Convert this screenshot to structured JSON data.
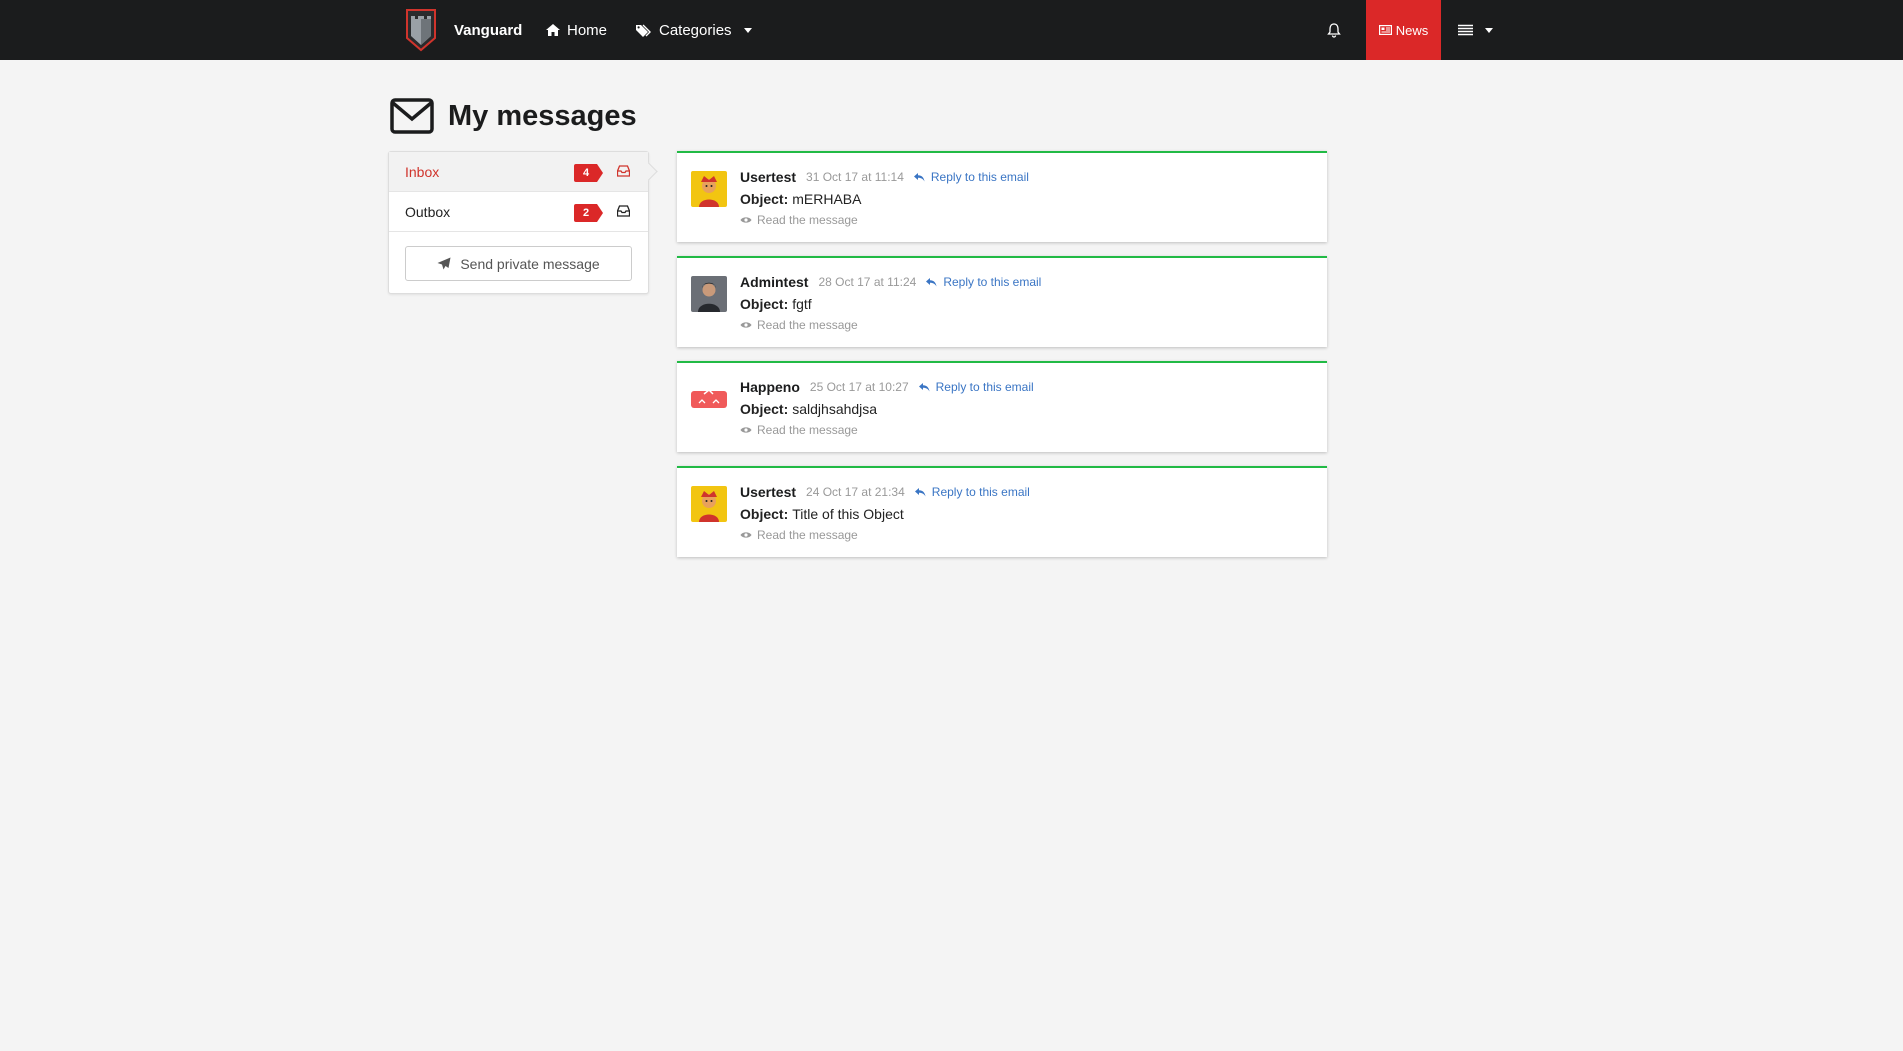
{
  "nav": {
    "brand": "Vanguard",
    "home": "Home",
    "categories": "Categories",
    "news": "News",
    "colors": {
      "bar": "#1b1c1d",
      "news_bg": "#db2828"
    }
  },
  "page": {
    "title": "My messages"
  },
  "sidebar": {
    "items": [
      {
        "label": "Inbox",
        "count": "4",
        "active": true
      },
      {
        "label": "Outbox",
        "count": "2",
        "active": false
      }
    ],
    "send_label": "Send private message"
  },
  "messages": [
    {
      "user": "Usertest",
      "date": "31 Oct 17 at 11:14",
      "reply": "Reply to this email",
      "object_label": "Object:",
      "object": "mERHABA",
      "read": "Read the message",
      "avatar": "yellow-character-avatar"
    },
    {
      "user": "Admintest",
      "date": "28 Oct 17 at 11:24",
      "reply": "Reply to this email",
      "object_label": "Object:",
      "object": "fgtf",
      "read": "Read the message",
      "avatar": "gray-person-avatar"
    },
    {
      "user": "Happeno",
      "date": "25 Oct 17 at 10:27",
      "reply": "Reply to this email",
      "object_label": "Object:",
      "object": "saldjhsahdjsa",
      "read": "Read the message",
      "avatar": "red-character-avatar"
    },
    {
      "user": "Usertest",
      "date": "24 Oct 17 at 21:34",
      "reply": "Reply to this email",
      "object_label": "Object:",
      "object": "Title of this Object",
      "read": "Read the message",
      "avatar": "yellow-character-avatar"
    }
  ],
  "colors": {
    "accent_red": "#db2828",
    "card_border": "#21ba45",
    "link_blue": "#3a75c4"
  }
}
